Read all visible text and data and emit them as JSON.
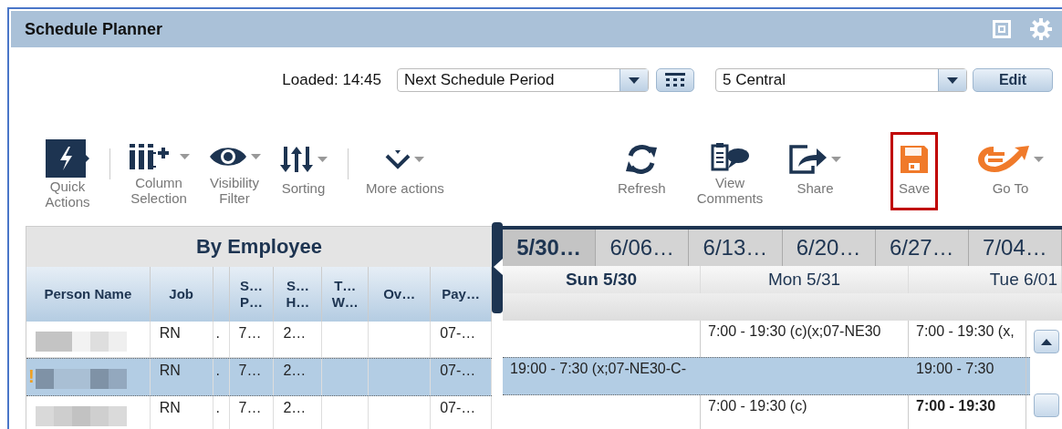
{
  "window": {
    "title": "Schedule Planner"
  },
  "header": {
    "loaded": "Loaded: 14:45",
    "period": {
      "value": "Next Schedule Period"
    },
    "location": {
      "value": "5 Central"
    },
    "edit_button": "Edit"
  },
  "toolbar": [
    {
      "kind": "quick",
      "label": "Quick Actions",
      "menu": false,
      "highlighted": false
    },
    {
      "kind": "columns",
      "label": "Column Selection",
      "menu": true,
      "highlighted": false
    },
    {
      "kind": "eye",
      "label": "Visibility Filter",
      "menu": true,
      "highlighted": false
    },
    {
      "kind": "sort",
      "label": "Sorting",
      "menu": true,
      "highlighted": false
    },
    {
      "kind": "more",
      "label": "More actions",
      "menu": true,
      "highlighted": false
    },
    {
      "kind": "refresh",
      "label": "Refresh",
      "menu": false,
      "highlighted": false
    },
    {
      "kind": "comments",
      "label": "View Comments",
      "menu": false,
      "highlighted": false
    },
    {
      "kind": "share",
      "label": "Share",
      "menu": true,
      "highlighted": false
    },
    {
      "kind": "save",
      "label": "Save",
      "menu": false,
      "highlighted": true
    },
    {
      "kind": "goto",
      "label": "Go To",
      "menu": true,
      "highlighted": false
    }
  ],
  "employee_grid": {
    "title": "By Employee",
    "columns": [
      "Person Name",
      "Job",
      "",
      "S… P…",
      "S… H…",
      "T… W…",
      "Ov…",
      "Pay…"
    ],
    "rows": [
      {
        "selected": false,
        "flag": "",
        "cells": [
          "",
          "RN",
          ".",
          "7…",
          "2…",
          "",
          "",
          "07-…"
        ]
      },
      {
        "selected": true,
        "flag": "!",
        "cells": [
          "",
          "RN",
          ".",
          "7…",
          "2…",
          "",
          "",
          "07-…"
        ]
      },
      {
        "selected": false,
        "flag": "",
        "cells": [
          "",
          "RN",
          ".",
          "7…",
          "2…",
          "",
          "",
          "07-…"
        ]
      }
    ]
  },
  "schedule": {
    "weeks": [
      {
        "label": "5/30…",
        "selected": true
      },
      {
        "label": "6/06…",
        "selected": false
      },
      {
        "label": "6/13…",
        "selected": false
      },
      {
        "label": "6/20…",
        "selected": false
      },
      {
        "label": "6/27…",
        "selected": false
      },
      {
        "label": "7/04…",
        "selected": false
      }
    ],
    "days": [
      {
        "label": "Sun 5/30",
        "current": true
      },
      {
        "label": "Mon 5/31",
        "current": false
      },
      {
        "label": "Tue 6/01",
        "current": false
      }
    ],
    "rows": [
      {
        "selected": false,
        "cells": [
          "",
          {
            "text": "7:00 - 19:30 (c)(x;07-NE30",
            "bold": false
          },
          {
            "text": "7:00 - 19:30 (x,",
            "bold": false
          }
        ]
      },
      {
        "selected": true,
        "cells": [
          {
            "text": "19:00 - 7:30 (x;07-NE30-C-",
            "bold": false
          },
          "",
          {
            "text": "19:00 - 7:30",
            "bold": false
          }
        ]
      },
      {
        "selected": false,
        "cells": [
          "",
          {
            "text": "7:00 - 19:30 (c)",
            "bold": false
          },
          {
            "text": "7:00 - 19:30",
            "bold": true
          }
        ]
      }
    ]
  }
}
